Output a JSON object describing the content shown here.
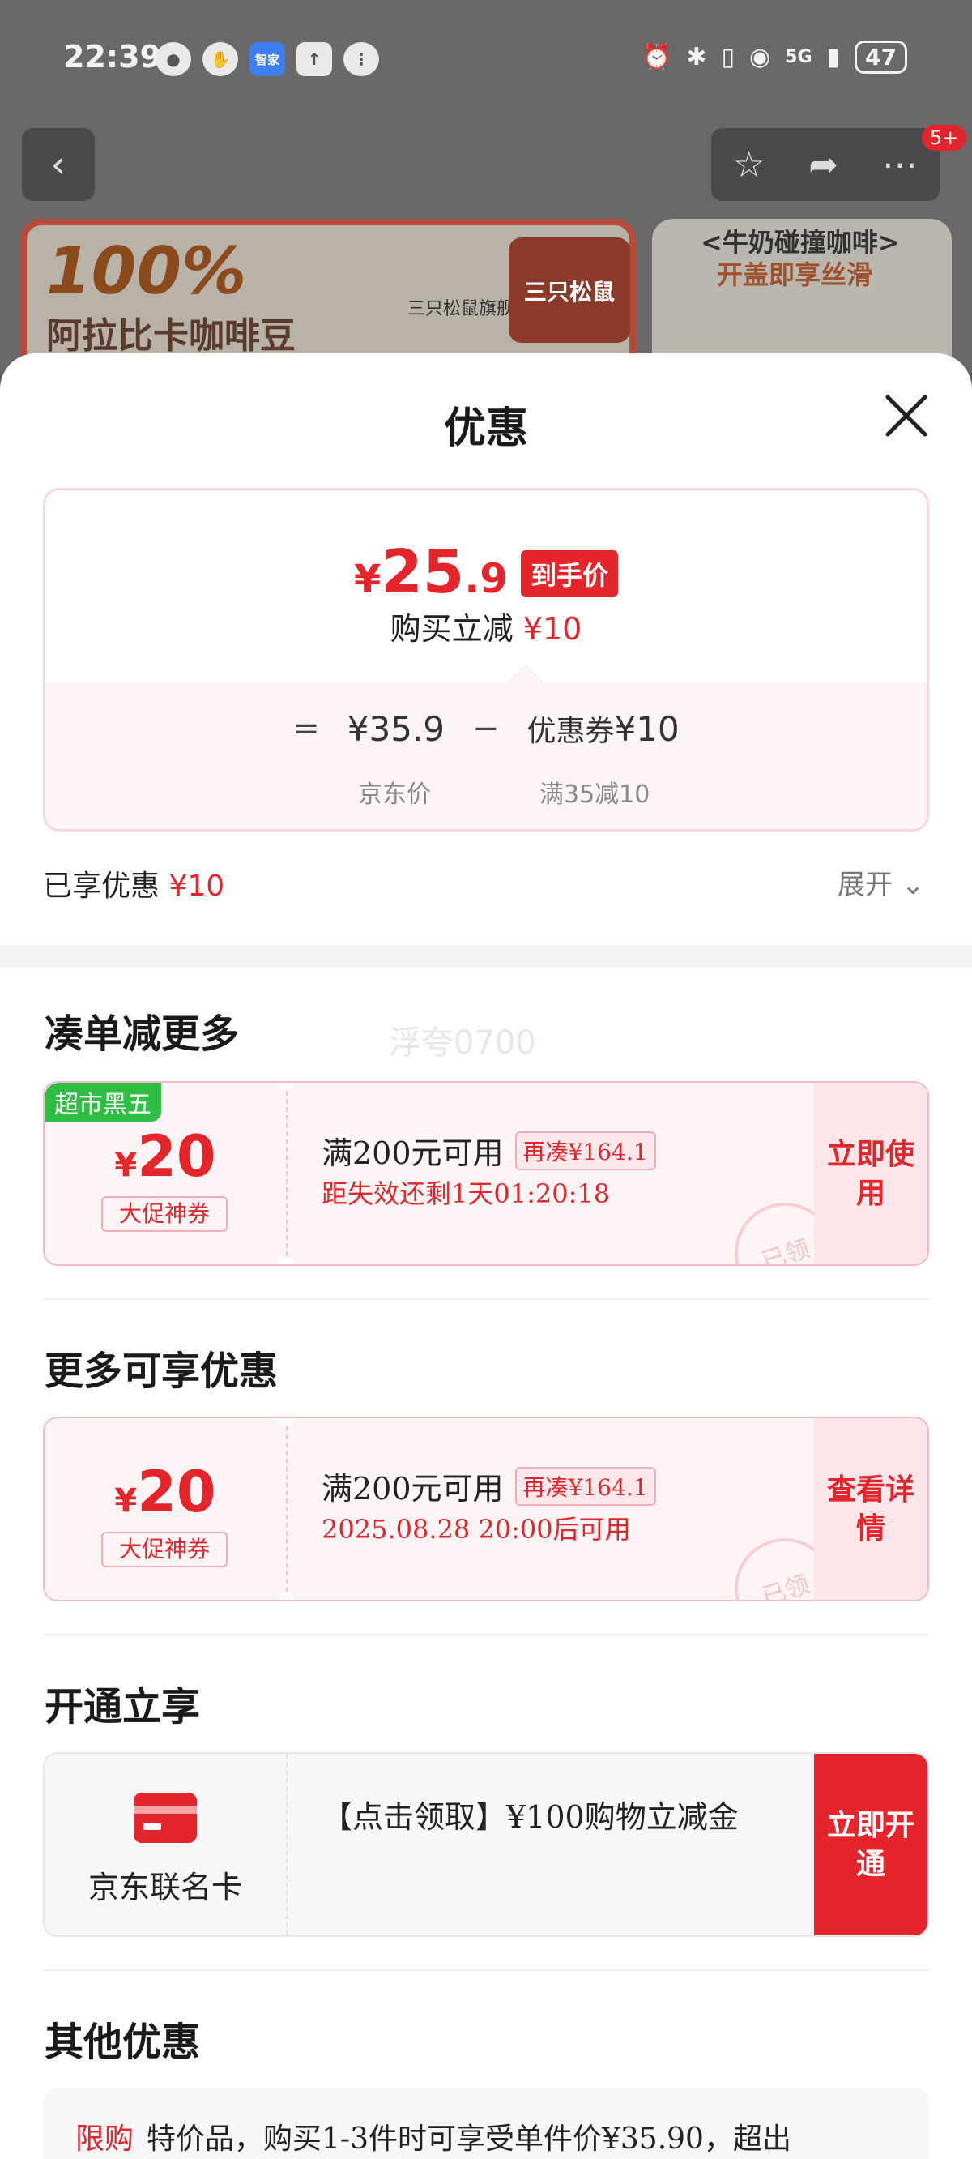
{
  "status_bar": {
    "time": "22:39",
    "left_icons": [
      "wechat-icon",
      "hand-icon",
      "zhijia-app-icon",
      "upload-icon",
      "voice-icon"
    ],
    "zhijia_label": "智家",
    "network": "5G",
    "battery": "47"
  },
  "background": {
    "nav_badge": "5+",
    "banner1_big": "100%",
    "banner1_sub": "阿拉比卡咖啡豆",
    "banner1_brand": "三只松鼠旗舰",
    "banner1_logo": "三只松鼠",
    "banner2_line1": "<牛奶碰撞咖啡>",
    "banner2_line2": "开盖即享丝滑"
  },
  "sheet": {
    "title": "优惠",
    "price": {
      "currency": "¥",
      "int": "25",
      "dec": ".9",
      "tag": "到手价",
      "sub_label": "购买立减",
      "sub_amount": "¥10",
      "equals": "=",
      "base_price": "¥35.9",
      "minus": "−",
      "coupon_label": "优惠券",
      "coupon_amount": "¥10",
      "base_label": "京东价",
      "coupon_rule": "满35减10"
    },
    "enjoyed_label": "已享优惠",
    "enjoyed_amount": "¥10",
    "expand_label": "展开",
    "watermark": "浮夸0700",
    "sections": {
      "more_savings": "凑单减更多",
      "more_offers": "更多可享优惠",
      "open_to_enjoy": "开通立享",
      "other_offers": "其他优惠"
    },
    "coupon1": {
      "tag": "超市黑五",
      "currency": "¥",
      "amount": "20",
      "type": "大促神券",
      "condition": "满200元可用",
      "more_needed": "再凑¥164.1",
      "time": "距失效还剩1天01:20:18",
      "action": "立即使用",
      "stamp": "已领"
    },
    "coupon2": {
      "currency": "¥",
      "amount": "20",
      "type": "大促神券",
      "condition": "满200元可用",
      "more_needed": "再凑¥164.1",
      "time": "2025.08.28 20:00后可用",
      "action": "查看详情",
      "stamp": "已领"
    },
    "card_offer": {
      "name": "京东联名卡",
      "desc": "【点击领取】¥100购物立减金",
      "action": "立即开通"
    },
    "other": {
      "badge": "限购",
      "text": "特价品，购买1-3件时可享受单件价¥35.90，超出"
    }
  }
}
